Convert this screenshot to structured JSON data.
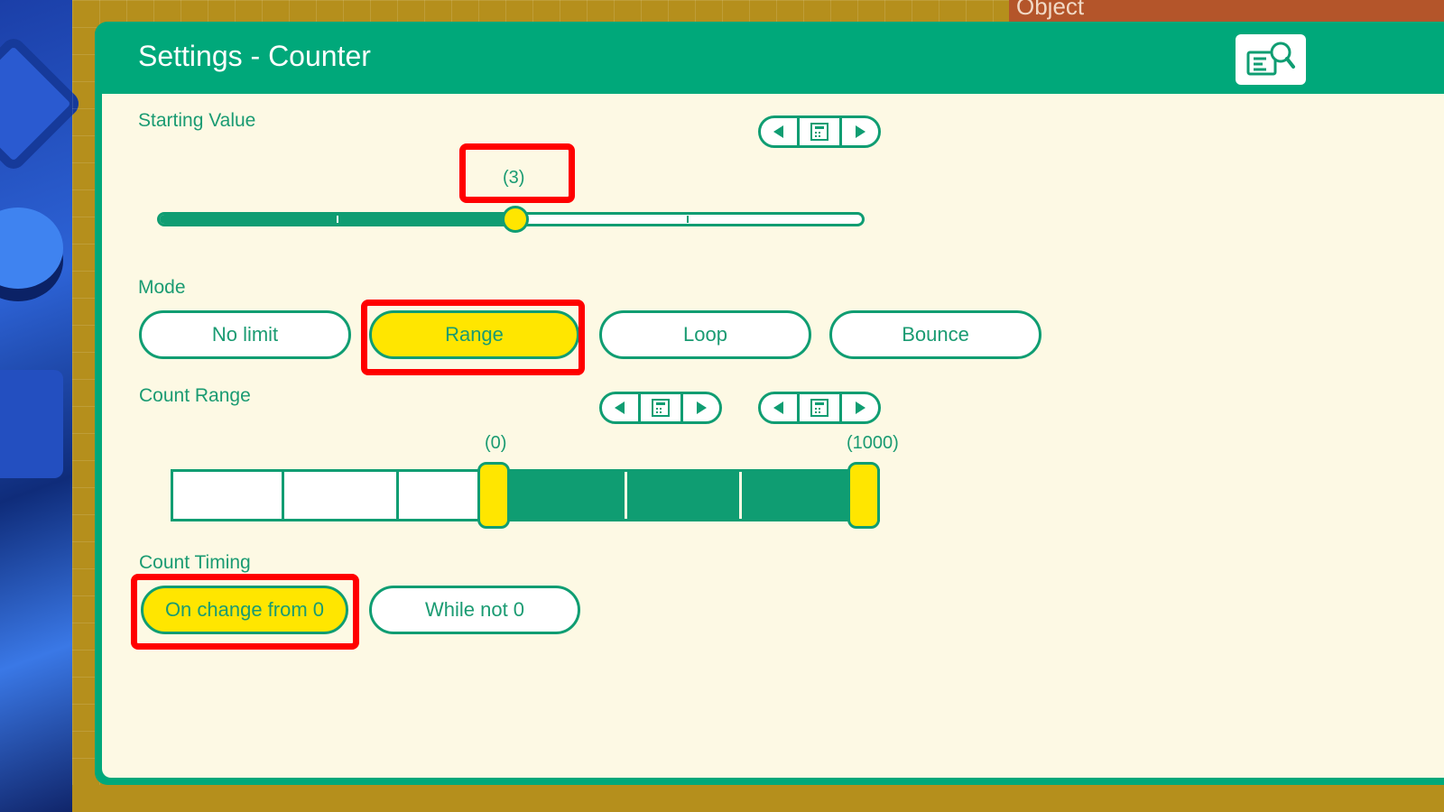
{
  "background": {
    "object_tab_label": "Object"
  },
  "panel": {
    "title": "Settings - Counter",
    "help_icon": "book-search-icon",
    "accent": "#00a87a",
    "highlight": "#ffe600"
  },
  "starting_value": {
    "label": "Starting Value",
    "value_display": "(3)",
    "value": 3
  },
  "mode": {
    "label": "Mode",
    "options": [
      "No limit",
      "Range",
      "Loop",
      "Bounce"
    ],
    "selected": "Range"
  },
  "count_range": {
    "label": "Count Range",
    "min_display": "(0)",
    "max_display": "(1000)",
    "min": 0,
    "max": 1000
  },
  "count_timing": {
    "label": "Count Timing",
    "options": [
      "On change from 0",
      "While not 0"
    ],
    "selected": "On change from 0"
  },
  "stepper_icons": {
    "left": "triangle-left-icon",
    "middle": "calculator-icon",
    "right": "triangle-right-icon"
  }
}
